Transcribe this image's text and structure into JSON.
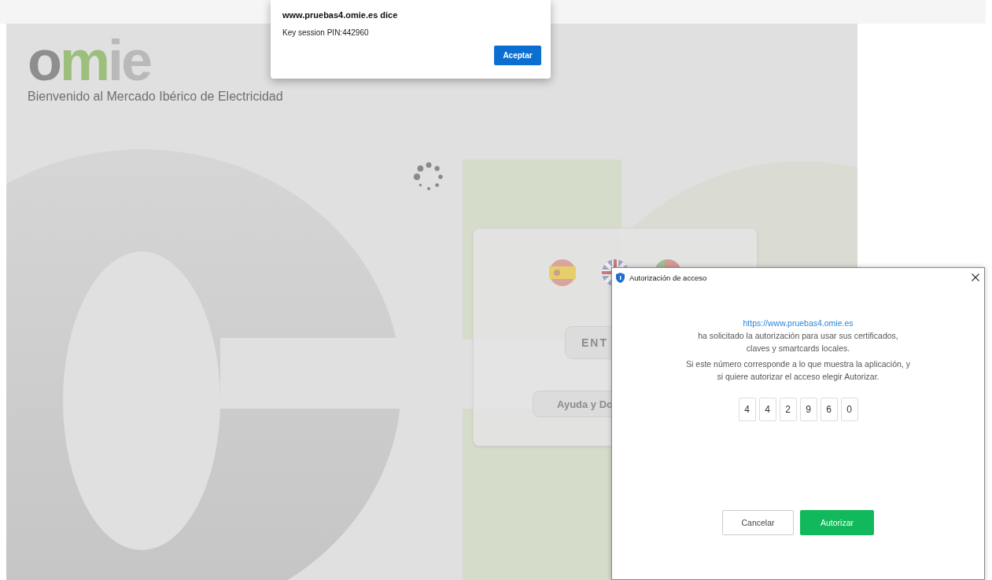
{
  "browser_alert": {
    "title": "www.pruebas4.omie.es dice",
    "message": "Key session PIN:442960",
    "button": "Aceptar"
  },
  "page": {
    "logo": [
      {
        "text": "o",
        "color": "#8e8e8e"
      },
      {
        "text": "m",
        "color": "#9cbf7c"
      },
      {
        "text": "ie",
        "color": "#b9b9b9"
      }
    ],
    "tagline": "Bienvenido al Mercado Ibérico de Electricidad",
    "login_card": {
      "flags": [
        {
          "kind": "spain"
        },
        {
          "kind": "uk"
        },
        {
          "kind": "portugal"
        }
      ],
      "enter_button": "ENT",
      "help_button": "Ayuda y Do"
    }
  },
  "auth_dialog": {
    "title": "Autorización de acceso",
    "url": "https://www.pruebas4.omie.es",
    "message_lines": [
      "ha solicitado la autorización para usar sus certificados,",
      "claves y smartcards locales."
    ],
    "instruction_lines": [
      "Si este número corresponde a lo que muestra la aplicación, y",
      "si quiere autorizar el acceso elegir Autorizar."
    ],
    "pin_digits": [
      "4",
      "4",
      "2",
      "9",
      "6",
      "0"
    ],
    "buttons": [
      {
        "label": "Cancelar",
        "kind": "secondary"
      },
      {
        "label": "Autorizar",
        "kind": "primary"
      }
    ]
  }
}
